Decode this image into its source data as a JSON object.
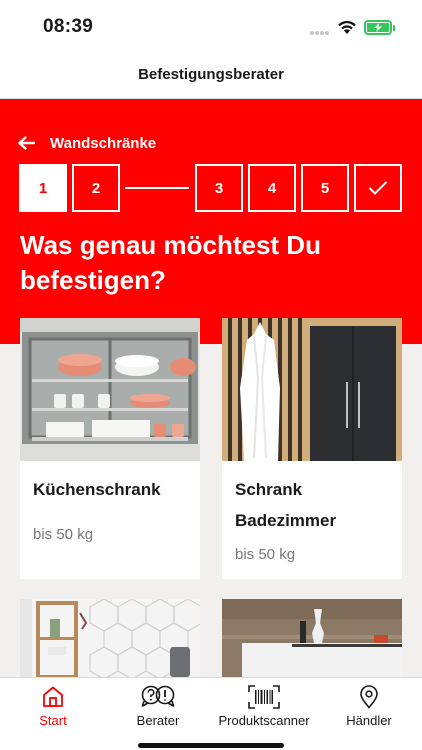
{
  "status": {
    "time": "08:39"
  },
  "header": {
    "title": "Befestigungsberater"
  },
  "breadcrumb": {
    "back_label": "Wandschränke"
  },
  "steps": [
    "1",
    "2",
    "3",
    "4",
    "5"
  ],
  "question": "Was genau möchtest Du befestigen?",
  "cards": [
    {
      "title": "Küchenschrank",
      "subtitle": "bis 50 kg"
    },
    {
      "title": "Schrank Badezimmer",
      "subtitle": "bis 50 kg"
    }
  ],
  "tabs": [
    {
      "label": "Start",
      "icon": "home-icon",
      "active": true
    },
    {
      "label": "Berater",
      "icon": "question-bubbles-icon",
      "active": false
    },
    {
      "label": "Produktscanner",
      "icon": "barcode-scanner-icon",
      "active": false
    },
    {
      "label": "Händler",
      "icon": "location-pin-icon",
      "active": false
    }
  ],
  "colors": {
    "brand_red": "#fe0000",
    "background": "#f1f0ef",
    "battery_green": "#34c759"
  }
}
